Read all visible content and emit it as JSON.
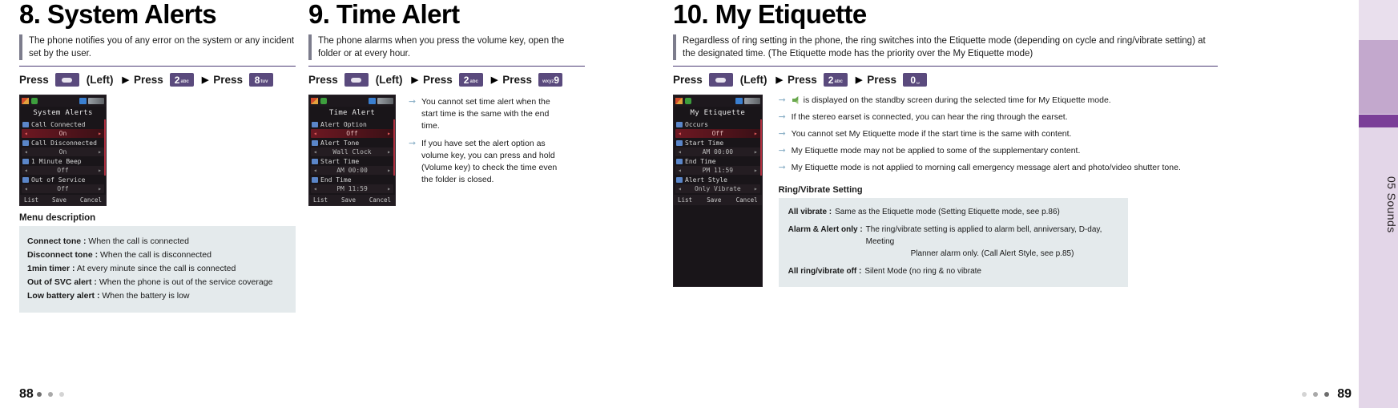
{
  "sidebar": {
    "chapter_label": "05 Sounds"
  },
  "footer": {
    "left_page": "88",
    "right_page": "89"
  },
  "sections": [
    {
      "number": "8.",
      "title": "System Alerts",
      "lead": "The phone notifies you of any error on the system or any incident set by the user.",
      "press": {
        "press_word_1": "Press",
        "left_label": "(Left)",
        "press_word_2": "Press",
        "key2_num": "2",
        "key2_sub": "abc",
        "press_word_3": "Press",
        "key3_num": "8",
        "key3_sub": "tuv",
        "arrow": "▶"
      },
      "phone": {
        "title": "System Alerts",
        "rows": [
          {
            "label": "Call Connected",
            "value": "On",
            "selected": true
          },
          {
            "label": "Call Disconnected",
            "value": "On",
            "selected": false
          },
          {
            "label": "1 Minute Beep",
            "value": "Off",
            "selected": false
          },
          {
            "label": "Out of Service",
            "value": "Off",
            "selected": false
          }
        ],
        "softkeys": {
          "left": "List",
          "center": "Save",
          "right": "Cancel"
        }
      },
      "menu_description": {
        "heading": "Menu description",
        "items": [
          {
            "term": "Connect tone :",
            "desc": "When the call is connected"
          },
          {
            "term": "Disconnect tone :",
            "desc": "When the call is disconnected"
          },
          {
            "term": "1min timer :",
            "desc": "At every minute since the call is connected"
          },
          {
            "term": "Out of SVC alert :",
            "desc": "When the phone is out of the service coverage"
          },
          {
            "term": "Low battery alert :",
            "desc": "When the battery is low"
          }
        ]
      }
    },
    {
      "number": "9.",
      "title": "Time Alert",
      "lead": "The phone alarms when you press the volume key, open the folder or at every hour.",
      "press": {
        "press_word_1": "Press",
        "left_label": "(Left)",
        "press_word_2": "Press",
        "key2_num": "2",
        "key2_sub": "abc",
        "press_word_3": "Press",
        "key3_num": "9",
        "key3_sub": "wxyz",
        "arrow": "▶"
      },
      "phone": {
        "title": "Time Alert",
        "rows": [
          {
            "label": "Alert Option",
            "value": "Off",
            "selected": true
          },
          {
            "label": "Alert Tone",
            "value": "Wall Clock",
            "selected": false
          },
          {
            "label": "Start Time",
            "value": "AM 00:00",
            "selected": false
          },
          {
            "label": "End Time",
            "value": "PM 11:59",
            "selected": false
          }
        ],
        "softkeys": {
          "left": "List",
          "center": "Save",
          "right": "Cancel"
        }
      },
      "bullets": [
        "You cannot set time alert when the start time is the same with the end time.",
        "If you have set the alert option as volume key, you can press and hold  (Volume key) to check the time even the folder is closed."
      ]
    },
    {
      "number": "10.",
      "title": "My Etiquette",
      "lead": "Regardless of ring setting in the phone, the ring switches into the Etiquette mode (depending on cycle and ring/vibrate setting) at the designated time. (The Etiquette mode has the priority over the My Etiquette mode)",
      "press": {
        "press_word_1": "Press",
        "left_label": "(Left)",
        "press_word_2": "Press",
        "key2_num": "2",
        "key2_sub": "abc",
        "press_word_3": "Press",
        "key3_num": "0",
        "key3_sub": "␣",
        "arrow": "▶"
      },
      "phone": {
        "title": "My Etiquette",
        "rows": [
          {
            "label": "Occurs",
            "value": "Off",
            "selected": true
          },
          {
            "label": "Start Time",
            "value": "AM 00:00",
            "selected": false
          },
          {
            "label": "End Time",
            "value": "PM 11:59",
            "selected": false
          },
          {
            "label": "Alert Style",
            "value": "Only Vibrate",
            "selected": false
          }
        ],
        "softkeys": {
          "left": "List",
          "center": "Save",
          "right": "Cancel"
        }
      },
      "bullets": [
        "is displayed on the standby screen during the selected time for My Etiquette mode.",
        "If the stereo earset is connected, you can hear the ring through the earset.",
        "You cannot set My Etiquette mode if the start time is the same with content.",
        "My Etiquette mode may not be applied to some of the supplementary content.",
        "My Etiquette mode is not applied to morning call emergency message alert and photo/video shutter tone."
      ],
      "ring_vibrate": {
        "heading": "Ring/Vibrate Setting",
        "rows": [
          {
            "label": "All vibrate :",
            "text": "Same as the Etiquette mode (Setting Etiquette mode, see p.86)",
            "text2": ""
          },
          {
            "label": "Alarm & Alert only :",
            "text": "The ring/vibrate setting is applied to alarm bell, anniversary, D-day, Meeting",
            "text2": "Planner alarm only. (Call Alert Style, see p.85)"
          },
          {
            "label": "All ring/vibrate off :",
            "text": "Silent Mode (no ring & no vibrate",
            "text2": ""
          }
        ]
      }
    }
  ],
  "colors": {
    "accent_purple": "#5a4a7d",
    "rule_purple": "#4b3a73",
    "box_bg": "#e4eaec",
    "rail_bg": "#e6dcea",
    "rail_dark": "#7b3f98"
  }
}
